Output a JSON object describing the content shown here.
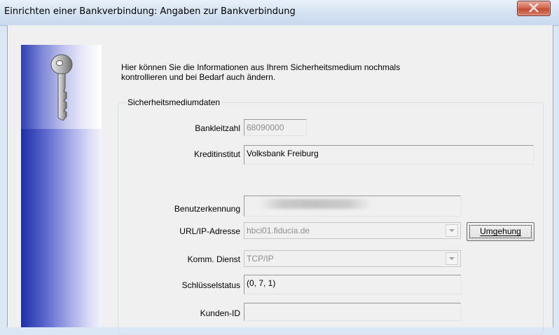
{
  "window": {
    "title": "Einrichten einer Bankverbindung: Angaben zur Bankverbindung",
    "close_icon": "close-icon"
  },
  "sidebar": {
    "icon": "key-icon"
  },
  "intro": {
    "line1": "Hier können Sie die Informationen aus Ihrem Sicherheitsmedium nochmals",
    "line2": "kontrollieren und bei Bedarf auch ändern."
  },
  "group": {
    "legend": "Sicherheitsmediumdaten",
    "fields": {
      "bankleitzahl": {
        "label": "Bankleitzahl",
        "value": "68090000"
      },
      "kreditinstitut": {
        "label": "Kreditinstitut",
        "value": "Volksbank Freiburg"
      },
      "benutzerkennung": {
        "label": "Benutzerkennung",
        "value": ""
      },
      "url": {
        "label": "URL/IP-Adresse",
        "value": "hbci01.fiducia.de"
      },
      "komm": {
        "label": "Komm. Dienst",
        "value": "TCP/IP"
      },
      "schluessel": {
        "label": "Schlüsselstatus",
        "value": "(0, 7, 1)"
      },
      "kunden_id": {
        "label": "Kunden-ID",
        "value": ""
      }
    },
    "umgehung_button": "Umgehung"
  }
}
